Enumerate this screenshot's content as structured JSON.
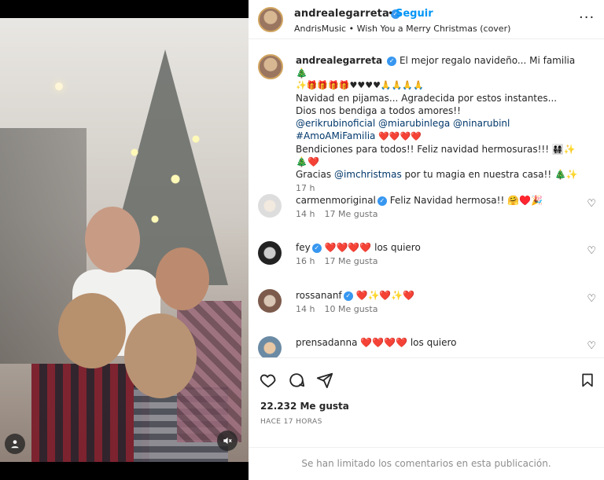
{
  "post": {
    "header": {
      "username": "andrealegarreta",
      "follow": "Seguir",
      "audio": "AndrisMusic • Wish You a Merry Christmas (cover)"
    },
    "caption": {
      "username": "andrealegarreta",
      "line1": "El mejor regalo navideño... Mi familia 🎄",
      "line2": "✨🎁🎁🎁🎁♥♥♥♥🙏🙏🙏🙏",
      "line3": "Navidad en pijamas... Agradecida por estos instantes... Dios nos bendiga a todos amores!!",
      "mention1": "@erikrubinoficial",
      "mention2": "@miarubinlega",
      "mention3": "@ninarubinl",
      "tag": "#AmoAMiFamilia",
      "hearts": "❤️❤️❤️❤️",
      "line4": "Bendiciones para todos!! Feliz navidad hermosuras!!! 👨‍👩‍👧‍👧✨🎄❤️",
      "line5": "Gracias",
      "mention4": "@imchristmas",
      "line6": "por tu magia en nuestra casa!! 🎄✨",
      "time": "17 h"
    },
    "comments": [
      {
        "username": "carmenmoriginal",
        "text": "Feliz Navidad hermosa!! 🤗♥️🎉",
        "time": "14 h",
        "likes": "17 Me gusta"
      },
      {
        "username": "fey",
        "text": "❤️❤️❤️❤️ los quiero",
        "time": "16 h",
        "likes": "17 Me gusta"
      },
      {
        "username": "rossananf",
        "text": "❤️✨❤️✨❤️",
        "time": "14 h",
        "likes": "10 Me gusta"
      },
      {
        "username": "prensadanna",
        "text": "❤️❤️❤️❤️ los quiero",
        "time": "",
        "likes": ""
      }
    ],
    "likes": "22.232 Me gusta",
    "time_ago": "HACE 17 HORAS",
    "limited_comments": "Se han limitado los comentarios en esta publicación.",
    "icons": {
      "like": "heart-icon",
      "comment": "comment-icon",
      "share": "share-icon",
      "save": "bookmark-icon",
      "more": "more-icon",
      "mute": "mute-icon",
      "user": "user-icon"
    }
  }
}
